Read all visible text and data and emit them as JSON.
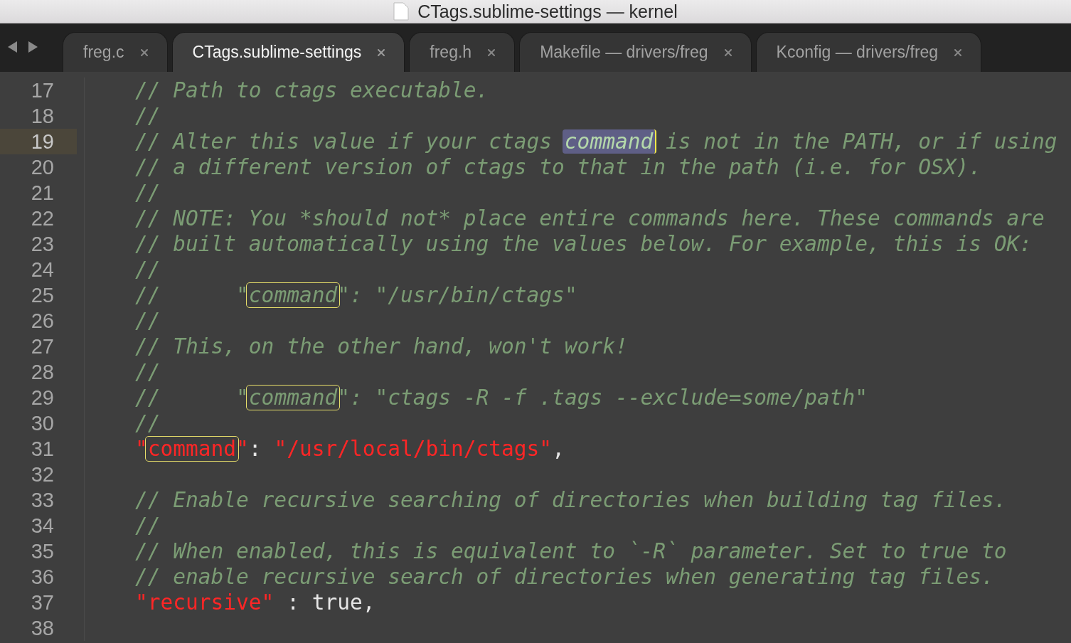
{
  "window": {
    "title": "CTags.sublime-settings — kernel"
  },
  "tabs": [
    {
      "label": "freg.c",
      "selected": false
    },
    {
      "label": "CTags.sublime-settings",
      "selected": true
    },
    {
      "label": "freg.h",
      "selected": false
    },
    {
      "label": "Makefile — drivers/freg",
      "selected": false
    },
    {
      "label": "Kconfig — drivers/freg",
      "selected": false
    }
  ],
  "editor": {
    "lines": [
      {
        "number": "17",
        "current": false,
        "tokens": [
          {
            "kind": "comment",
            "text": "// Path to ctags executable."
          }
        ]
      },
      {
        "number": "18",
        "current": false,
        "tokens": [
          {
            "kind": "comment",
            "text": "//"
          }
        ]
      },
      {
        "number": "19",
        "current": true,
        "tokens": [
          {
            "kind": "comment",
            "text": "// Alter this value if your ctags "
          },
          {
            "kind": "comment",
            "text": "command",
            "selected": true
          },
          {
            "kind": "comment",
            "text": " is not in the PATH, or if using"
          }
        ]
      },
      {
        "number": "20",
        "current": false,
        "tokens": [
          {
            "kind": "comment",
            "text": "// a different version of ctags to that in the path (i.e. for OSX)."
          }
        ]
      },
      {
        "number": "21",
        "current": false,
        "tokens": [
          {
            "kind": "comment",
            "text": "//"
          }
        ]
      },
      {
        "number": "22",
        "current": false,
        "tokens": [
          {
            "kind": "comment",
            "text": "// NOTE: You *should not* place entire commands here. These commands are"
          }
        ]
      },
      {
        "number": "23",
        "current": false,
        "tokens": [
          {
            "kind": "comment",
            "text": "// built automatically using the values below. For example, this is OK:"
          }
        ]
      },
      {
        "number": "24",
        "current": false,
        "tokens": [
          {
            "kind": "comment",
            "text": "//"
          }
        ]
      },
      {
        "number": "25",
        "current": false,
        "tokens": [
          {
            "kind": "comment",
            "text": "//      \""
          },
          {
            "kind": "comment",
            "text": "command",
            "search_match": true
          },
          {
            "kind": "comment",
            "text": "\": \"/usr/bin/ctags\""
          }
        ]
      },
      {
        "number": "26",
        "current": false,
        "tokens": [
          {
            "kind": "comment",
            "text": "//"
          }
        ]
      },
      {
        "number": "27",
        "current": false,
        "tokens": [
          {
            "kind": "comment",
            "text": "// This, on the other hand, won't work!"
          }
        ]
      },
      {
        "number": "28",
        "current": false,
        "tokens": [
          {
            "kind": "comment",
            "text": "//"
          }
        ]
      },
      {
        "number": "29",
        "current": false,
        "tokens": [
          {
            "kind": "comment",
            "text": "//      \""
          },
          {
            "kind": "comment",
            "text": "command",
            "search_match": true
          },
          {
            "kind": "comment",
            "text": "\": \"ctags -R -f .tags --exclude=some/path\""
          }
        ]
      },
      {
        "number": "30",
        "current": false,
        "tokens": [
          {
            "kind": "comment",
            "text": "//"
          }
        ]
      },
      {
        "number": "31",
        "current": false,
        "tokens": [
          {
            "kind": "string",
            "text": "\""
          },
          {
            "kind": "string",
            "text": "command",
            "search_match": true
          },
          {
            "kind": "string",
            "text": "\""
          },
          {
            "kind": "punct",
            "text": ": "
          },
          {
            "kind": "string",
            "text": "\"/usr/local/bin/ctags\""
          },
          {
            "kind": "punct",
            "text": ","
          }
        ]
      },
      {
        "number": "32",
        "current": false
      },
      {
        "number": "33",
        "current": false,
        "tokens": [
          {
            "kind": "comment",
            "text": "// Enable recursive searching of directories when building tag files."
          }
        ]
      },
      {
        "number": "34",
        "current": false,
        "tokens": [
          {
            "kind": "comment",
            "text": "//"
          }
        ]
      },
      {
        "number": "35",
        "current": false,
        "tokens": [
          {
            "kind": "comment",
            "text": "// When enabled, this is equivalent to `-R` parameter. Set to true to"
          }
        ]
      },
      {
        "number": "36",
        "current": false,
        "tokens": [
          {
            "kind": "comment",
            "text": "// enable recursive search of directories when generating tag files."
          }
        ]
      },
      {
        "number": "37",
        "current": false,
        "tokens": [
          {
            "kind": "string",
            "text": "\"recursive\""
          },
          {
            "kind": "punct",
            "text": " : true,"
          }
        ]
      },
      {
        "number": "38",
        "current": false
      }
    ]
  }
}
